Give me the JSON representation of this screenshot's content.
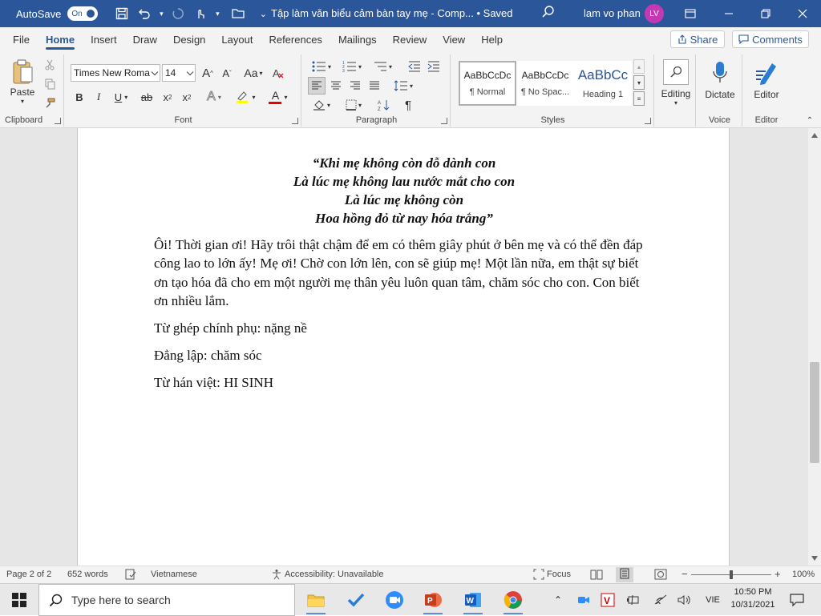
{
  "titlebar": {
    "autosave_label": "AutoSave",
    "autosave_state": "On",
    "doc_title": "Tập làm văn biểu cảm bàn tay mẹ  -  Comp...  •  Saved",
    "user_name": "lam vo phan",
    "user_initials": "LV"
  },
  "menu": {
    "tabs": [
      "File",
      "Home",
      "Insert",
      "Draw",
      "Design",
      "Layout",
      "References",
      "Mailings",
      "Review",
      "View",
      "Help"
    ],
    "active": "Home",
    "share_label": "Share",
    "comments_label": "Comments"
  },
  "ribbon": {
    "clipboard": {
      "paste_label": "Paste",
      "group_label": "Clipboard"
    },
    "font": {
      "font_name": "Times New Roma",
      "font_size": "14",
      "grow": "A",
      "shrink": "A",
      "case": "Aa",
      "bold": "B",
      "italic": "I",
      "underline": "U",
      "strike": "ab",
      "subscript": "x",
      "superscript": "x",
      "effects": "A",
      "font_color_letter": "A",
      "group_label": "Font"
    },
    "paragraph": {
      "group_label": "Paragraph",
      "pilcrow": "¶"
    },
    "styles": {
      "items": [
        {
          "preview": "AaBbCcDc",
          "name": "¶ Normal"
        },
        {
          "preview": "AaBbCcDc",
          "name": "¶ No Spac..."
        },
        {
          "preview": "AaBbCc",
          "name": "Heading 1"
        }
      ],
      "group_label": "Styles"
    },
    "editing": {
      "label": "Editing"
    },
    "voice": {
      "dictate_label": "Dictate",
      "group_label": "Voice"
    },
    "editor": {
      "label": "Editor",
      "group_label": "Editor"
    }
  },
  "document": {
    "poem": [
      "“Khi mẹ không còn dỗ dành con",
      "Là lúc mẹ không lau nước mắt cho con",
      "Là lúc mẹ không còn",
      "Hoa hồng đỏ từ nay hóa trắng”"
    ],
    "paragraph": "Ôi! Thời gian ơi! Hãy trôi thật chậm để em có thêm giây phút ở bên mẹ và có thể đền đáp công lao to lớn ấy! Mẹ ơi! Chờ con lớn lên, con sẽ giúp mẹ! Một lần nữa, em thật sự biết ơn tạo hóa đã cho em một người mẹ thân yêu luôn quan tâm, chăm sóc cho con. Con biết ơn nhiều lắm.",
    "line1": "Từ ghép chính phụ: nặng nề",
    "line2": "Đẳng lập: chăm sóc",
    "line3": "Từ hán việt: HI SINH"
  },
  "status": {
    "page": "Page 2 of 2",
    "words": "652 words",
    "language": "Vietnamese",
    "accessibility": "Accessibility: Unavailable",
    "focus": "Focus",
    "zoom": "100%",
    "zoom_minus": "−",
    "zoom_plus": "+"
  },
  "taskbar": {
    "search_placeholder": "Type here to search",
    "lang": "VIE",
    "time": "10:50 PM",
    "date": "10/31/2021"
  },
  "colors": {
    "title_bg": "#2b579a",
    "avatar": "#c239b3",
    "accent": "#2b579a"
  }
}
